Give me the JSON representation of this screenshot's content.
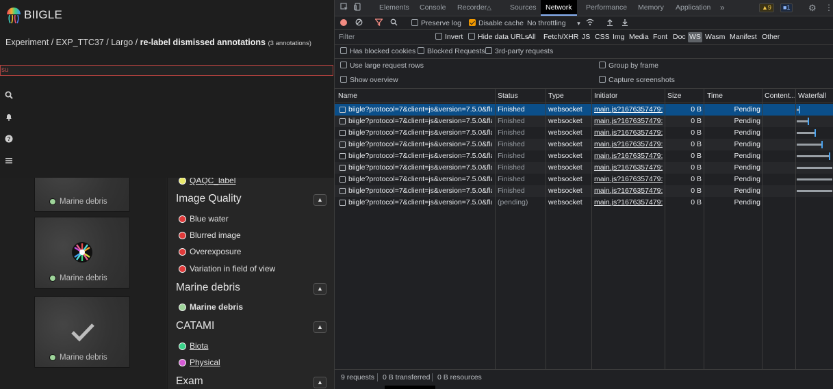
{
  "app": {
    "brand": "BIIGLE",
    "breadcrumb": {
      "prefix": "Experiment / EXP_TTC37 / Largo / ",
      "current": "re-label dismissed annotations",
      "count": "(3 annotations)"
    },
    "filter_value": "su",
    "side_icons": [
      "search-icon",
      "bell-icon",
      "help-icon",
      "menu-icon"
    ],
    "thumbnails": [
      {
        "label": "Marine debris",
        "dot_color": "#9ed49a"
      },
      {
        "label": "Marine debris",
        "dot_color": "#9ed49a"
      },
      {
        "label": "Marine debris",
        "dot_color": "#9ed49a"
      }
    ],
    "label_groups": {
      "partial_item": {
        "label": "QAQC_label",
        "color": "#e8e86a"
      },
      "image_quality": {
        "title": "Image Quality",
        "items": [
          {
            "label": "Blue water",
            "color": "#e03a3a"
          },
          {
            "label": "Blurred image",
            "color": "#e03a3a"
          },
          {
            "label": "Overexposure",
            "color": "#e03a3a"
          },
          {
            "label": "Variation in field of view",
            "color": "#e03a3a"
          }
        ]
      },
      "marine_debris": {
        "title": "Marine debris",
        "items": [
          {
            "label": "Marine debris",
            "color": "#9ed49a"
          }
        ]
      },
      "catami": {
        "title": "CATAMI",
        "items": [
          {
            "label": "Biota",
            "color": "#3ad48a"
          },
          {
            "label": "Physical",
            "color": "#d45ad4"
          }
        ]
      },
      "exam": {
        "title": "Exam"
      }
    }
  },
  "devtools": {
    "tabs": [
      "Elements",
      "Console",
      "Recorder",
      "Sources",
      "Network",
      "Performance",
      "Memory",
      "Application"
    ],
    "active_tab": "Network",
    "warn_count": "9",
    "info_count": "1",
    "toolbar": {
      "preserve_log": "Preserve log",
      "disable_cache": "Disable cache",
      "throttling": "No throttling"
    },
    "filter": {
      "placeholder": "Filter",
      "invert": "Invert",
      "hide_data_urls": "Hide data URLs",
      "types": [
        "All",
        "Fetch/XHR",
        "JS",
        "CSS",
        "Img",
        "Media",
        "Font",
        "Doc",
        "WS",
        "Wasm",
        "Manifest",
        "Other"
      ],
      "active_type": "WS"
    },
    "options": {
      "blocked_cookies": "Has blocked cookies",
      "blocked_requests": "Blocked Requests",
      "third_party": "3rd-party requests",
      "large_rows": "Use large request rows",
      "group_by_frame": "Group by frame",
      "show_overview": "Show overview",
      "capture_screenshots": "Capture screenshots"
    },
    "columns": [
      "Name",
      "Status",
      "Type",
      "Initiator",
      "Size",
      "Time",
      "Content...",
      "Waterfall"
    ],
    "rows": [
      {
        "name": "biigle?protocol=7&client=js&version=7.5.0&fla...",
        "status": "Finished",
        "type": "websocket",
        "initiator": "main.js?1676357479:2",
        "size": "0 B",
        "time": "Pending",
        "wf_fraction": 0.06
      },
      {
        "name": "biigle?protocol=7&client=js&version=7.5.0&fla...",
        "status": "Finished",
        "type": "websocket",
        "initiator": "main.js?1676357479:2",
        "size": "0 B",
        "time": "Pending",
        "wf_fraction": 0.3
      },
      {
        "name": "biigle?protocol=7&client=js&version=7.5.0&fla...",
        "status": "Finished",
        "type": "websocket",
        "initiator": "main.js?1676357479:2",
        "size": "0 B",
        "time": "Pending",
        "wf_fraction": 0.5
      },
      {
        "name": "biigle?protocol=7&client=js&version=7.5.0&fla...",
        "status": "Finished",
        "type": "websocket",
        "initiator": "main.js?1676357479:2",
        "size": "0 B",
        "time": "Pending",
        "wf_fraction": 0.7
      },
      {
        "name": "biigle?protocol=7&client=js&version=7.5.0&fla...",
        "status": "Finished",
        "type": "websocket",
        "initiator": "main.js?1676357479:2",
        "size": "0 B",
        "time": "Pending",
        "wf_fraction": 0.9
      },
      {
        "name": "biigle?protocol=7&client=js&version=7.5.0&fla...",
        "status": "Finished",
        "type": "websocket",
        "initiator": "main.js?1676357479:2",
        "size": "0 B",
        "time": "Pending",
        "wf_fraction": 1.0
      },
      {
        "name": "biigle?protocol=7&client=js&version=7.5.0&fla...",
        "status": "Finished",
        "type": "websocket",
        "initiator": "main.js?1676357479:2",
        "size": "0 B",
        "time": "Pending",
        "wf_fraction": 1.0
      },
      {
        "name": "biigle?protocol=7&client=js&version=7.5.0&fla...",
        "status": "Finished",
        "type": "websocket",
        "initiator": "main.js?1676357479:2",
        "size": "0 B",
        "time": "Pending",
        "wf_fraction": 1.0
      },
      {
        "name": "biigle?protocol=7&client=js&version=7.5.0&fla...",
        "status": "(pending)",
        "type": "websocket",
        "initiator": "main.js?1676357479:2",
        "size": "0 B",
        "time": "Pending",
        "wf_fraction": 0
      }
    ],
    "status": {
      "requests": "9 requests",
      "transferred": "0 B transferred",
      "resources": "0 B resources"
    }
  }
}
